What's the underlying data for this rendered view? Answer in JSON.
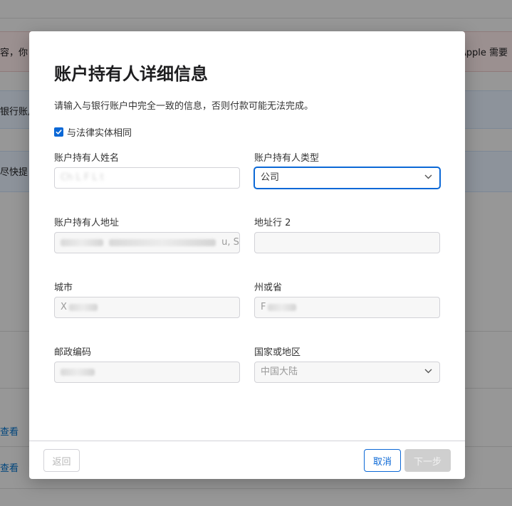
{
  "background": {
    "alert_left_text": "容，你",
    "alert_right_text": "Apple 需要",
    "band1_text": "银行账户",
    "band2_text": "尽快提",
    "links": [
      "查看",
      "查看"
    ]
  },
  "modal": {
    "title": "账户持有人详细信息",
    "description": "请输入与银行账户中完全一致的信息，否则付款可能无法完成。",
    "same_as_entity": {
      "label": "与法律实体相同",
      "checked": true
    },
    "fields": {
      "holder_name": {
        "label": "账户持有人姓名",
        "value": "Ch  L  F   L t  "
      },
      "holder_type": {
        "label": "账户持有人类型",
        "value": "公司"
      },
      "address": {
        "label": "账户持有人地址",
        "value": "         u, Sl"
      },
      "address_line2": {
        "label": "地址行 2",
        "value": ""
      },
      "city": {
        "label": "城市",
        "value": "X"
      },
      "state": {
        "label": "州或省",
        "value": "F"
      },
      "postal_code": {
        "label": "邮政编码",
        "value": ""
      },
      "country": {
        "label": "国家或地区",
        "value": "中国大陆"
      }
    },
    "buttons": {
      "back": "返回",
      "cancel": "取消",
      "next": "下一步"
    }
  },
  "colors": {
    "accent": "#0b68d6",
    "disabled_bg": "#f7f7f7",
    "next_disabled": "#cfcfcf"
  }
}
